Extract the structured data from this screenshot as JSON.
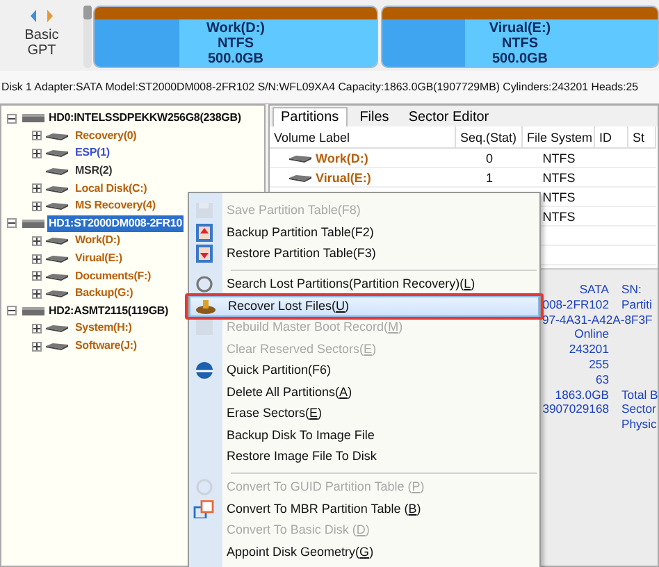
{
  "disk_map": {
    "style_label": [
      "Basic",
      "GPT"
    ],
    "partitions": [
      {
        "name": "Work(D:)",
        "file_system": "NTFS",
        "size": "500.0GB"
      },
      {
        "name": "Virual(E:)",
        "file_system": "NTFS",
        "size": "500.0GB"
      }
    ]
  },
  "disk_info": "Disk 1 Adapter:SATA  Model:ST2000DM008-2FR102  S/N:WFL09XA4  Capacity:1863.0GB(1907729MB)  Cylinders:243201  Heads:25",
  "tree": [
    {
      "label": "HD0:INTELSSDPEKKW256G8(238GB)",
      "kind": "disk",
      "expanded": true,
      "selected": false,
      "children": [
        {
          "label": "Recovery(0)",
          "kind": "partition",
          "color": "#b8600a",
          "expandable": true,
          "selected": false
        },
        {
          "label": "ESP(1)",
          "kind": "partition",
          "color": "#3a4fd0",
          "expandable": true,
          "selected": false
        },
        {
          "label": "MSR(2)",
          "kind": "partition",
          "color": "#333333",
          "expandable": false,
          "selected": false
        },
        {
          "label": "Local Disk(C:)",
          "kind": "partition",
          "color": "#b8600a",
          "expandable": true,
          "selected": false
        },
        {
          "label": "MS Recovery(4)",
          "kind": "partition",
          "color": "#b8600a",
          "expandable": true,
          "selected": false
        }
      ]
    },
    {
      "label": "HD1:ST2000DM008-2FR10",
      "kind": "disk",
      "expanded": true,
      "selected": true,
      "children": [
        {
          "label": "Work(D:)",
          "kind": "partition",
          "color": "#b8600a",
          "expandable": true,
          "selected": false
        },
        {
          "label": "Virual(E:)",
          "kind": "partition",
          "color": "#b8600a",
          "expandable": true,
          "selected": false
        },
        {
          "label": "Documents(F:)",
          "kind": "partition",
          "color": "#b8600a",
          "expandable": true,
          "selected": false
        },
        {
          "label": "Backup(G:)",
          "kind": "partition",
          "color": "#b8600a",
          "expandable": true,
          "selected": false
        }
      ]
    },
    {
      "label": "HD2:ASMT2115(119GB)",
      "kind": "disk",
      "expanded": true,
      "selected": false,
      "children": [
        {
          "label": "System(H:)",
          "kind": "partition",
          "color": "#b8600a",
          "expandable": true,
          "selected": false
        },
        {
          "label": "Software(J:)",
          "kind": "partition",
          "color": "#b8600a",
          "expandable": true,
          "selected": false
        }
      ]
    }
  ],
  "tabs": [
    {
      "label": "Partitions",
      "selected": true
    },
    {
      "label": "Files",
      "selected": false
    },
    {
      "label": "Sector Editor",
      "selected": false
    }
  ],
  "table": {
    "columns": [
      "Volume Label",
      "Seq.(Stat)",
      "File System",
      "ID",
      "St"
    ],
    "rows": [
      {
        "volume_label": "Work(D:)",
        "seq": "0",
        "file_system": "NTFS"
      },
      {
        "volume_label": "Virual(E:)",
        "seq": "1",
        "file_system": "NTFS"
      },
      {
        "file_system": "NTFS"
      },
      {
        "file_system": "NTFS"
      }
    ]
  },
  "details": [
    {
      "value": "SATA",
      "label": "SN:"
    },
    {
      "value": "008-2FR102",
      "label": "Partiti"
    },
    {
      "value": "97-4A31-A42A-8F3F"
    },
    {
      "value": "Online"
    },
    {
      "value": "243201"
    },
    {
      "value": "255"
    },
    {
      "value": "63"
    },
    {
      "value": "1863.0GB",
      "label": "Total B"
    },
    {
      "value": "3907029168",
      "label": "Sector"
    },
    {
      "label": "Physic"
    }
  ],
  "context_menu": [
    {
      "kind": "save",
      "text": "Save Partition Table(F8)",
      "disabled": true,
      "highlighted": false,
      "underline_key": false
    },
    {
      "kind": "backup",
      "text": "Backup Partition Table(F2)",
      "disabled": false,
      "highlighted": false,
      "underline_key": false
    },
    {
      "kind": "restore",
      "text": "Restore Partition Table(F3)",
      "disabled": false,
      "highlighted": false,
      "underline_key": false
    },
    {
      "kind": "separator"
    },
    {
      "kind": "search",
      "text": "Search Lost Partitions(Partition Recovery)(L)",
      "disabled": false,
      "highlighted": false,
      "underline_key": true
    },
    {
      "kind": "recover",
      "text": "Recover Lost Files(U)",
      "disabled": false,
      "highlighted": true,
      "underline_key": true
    },
    {
      "kind": "rebuild",
      "text": "Rebuild Master Boot Record(M)",
      "disabled": true,
      "highlighted": false,
      "underline_key": true
    },
    {
      "kind": "plain",
      "text": "Clear Reserved Sectors(E)",
      "disabled": true,
      "highlighted": false,
      "underline_key": true
    },
    {
      "kind": "quick",
      "text": "Quick Partition(F6)",
      "disabled": false,
      "highlighted": false,
      "underline_key": false
    },
    {
      "kind": "plain",
      "text": "Delete All Partitions(A)",
      "disabled": false,
      "highlighted": false,
      "underline_key": true
    },
    {
      "kind": "plain",
      "text": "Erase Sectors(E)",
      "disabled": false,
      "highlighted": false,
      "underline_key": true
    },
    {
      "kind": "plain",
      "text": "Backup Disk To Image File",
      "disabled": false,
      "highlighted": false,
      "underline_key": false
    },
    {
      "kind": "plain",
      "text": "Restore Image File To Disk",
      "disabled": false,
      "highlighted": false,
      "underline_key": false
    },
    {
      "kind": "separator"
    },
    {
      "kind": "convert",
      "text": "Convert To GUID Partition Table (P)",
      "disabled": true,
      "highlighted": false,
      "underline_key": true
    },
    {
      "kind": "mbr",
      "text": "Convert To MBR Partition Table (B)",
      "disabled": false,
      "highlighted": false,
      "underline_key": true
    },
    {
      "kind": "plain",
      "text": "Convert To Basic Disk (D)",
      "disabled": true,
      "highlighted": false,
      "underline_key": true
    },
    {
      "kind": "plain",
      "text": "Appoint Disk Geometry(G)",
      "disabled": false,
      "highlighted": false,
      "underline_key": true
    }
  ]
}
